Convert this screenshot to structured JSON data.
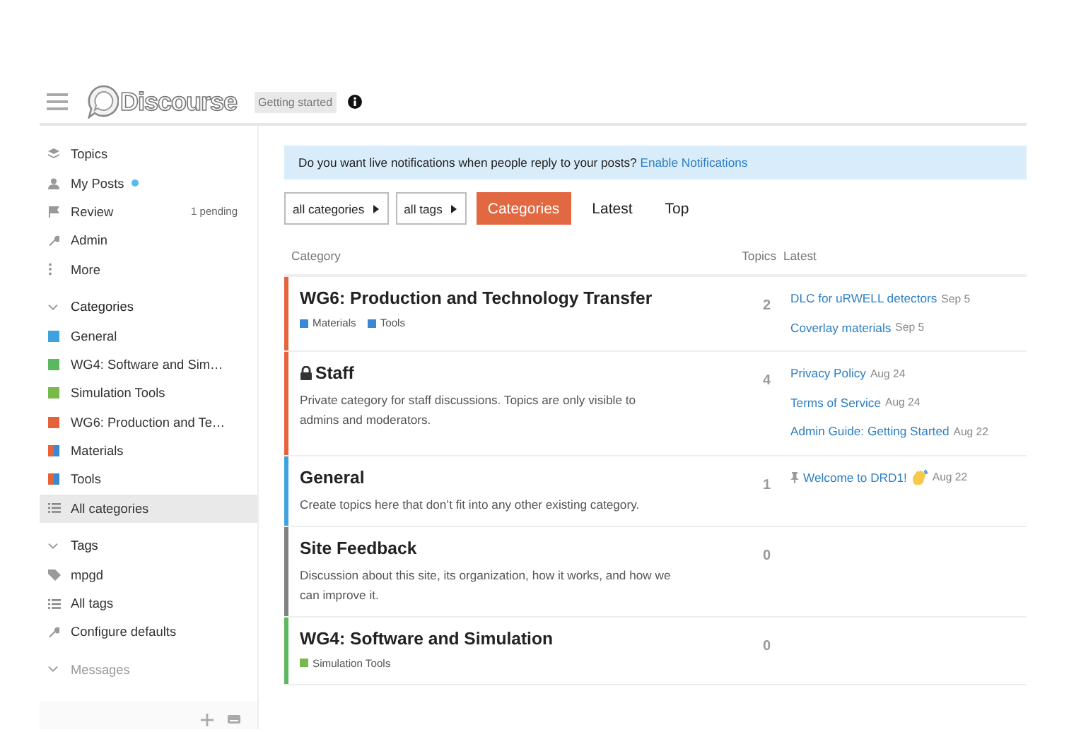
{
  "header": {
    "logo": "Discourse",
    "badge": "Getting started"
  },
  "sidebar": {
    "items": [
      {
        "kind": "topics",
        "label": "Topics"
      },
      {
        "kind": "my-posts",
        "label": "My Posts",
        "unread": true
      },
      {
        "kind": "review",
        "label": "Review",
        "count": "1 pending"
      },
      {
        "kind": "admin",
        "label": "Admin"
      },
      {
        "kind": "more",
        "label": "More"
      }
    ],
    "sections": [
      {
        "title": "Categories",
        "expanded": true,
        "items": [
          {
            "kind": "category",
            "label": "General",
            "color": "#3ea1e0",
            "selected": false
          },
          {
            "kind": "category",
            "label": "WG4: Software and Sim…",
            "color": "#5cb85c",
            "selected": false
          },
          {
            "kind": "category",
            "label": "Simulation Tools",
            "color": "#78b94a",
            "selected": false
          },
          {
            "kind": "category",
            "label": "WG6: Production and Te…",
            "color": "#e5623a",
            "selected": false
          },
          {
            "kind": "subcategory",
            "label": "Materials",
            "color": "#3c86d6",
            "parent": {
              "color": "#e5623a"
            },
            "selected": false
          },
          {
            "kind": "subcategory",
            "label": "Tools",
            "color": "#3c86d6",
            "parent": {
              "color": "#e5623a"
            },
            "selected": false
          },
          {
            "kind": "all",
            "label": "All categories",
            "selected": true
          }
        ]
      },
      {
        "title": "Tags",
        "expanded": true,
        "items": [
          {
            "kind": "tag",
            "label": "mpgd",
            "selected": false
          },
          {
            "kind": "all",
            "label": "All tags",
            "selected": false
          },
          {
            "kind": "configure",
            "label": "Configure defaults",
            "selected": false
          }
        ]
      },
      {
        "title": "Messages",
        "expanded": true,
        "dimmed": true
      }
    ]
  },
  "banner": {
    "text": "Do you want live notifications when people reply to your posts?",
    "link": "Enable Notifications"
  },
  "filters": [
    "all categories",
    "all tags"
  ],
  "tabs": [
    {
      "label": "Categories",
      "selected": true
    },
    {
      "label": "Latest",
      "selected": false
    },
    {
      "label": "Top",
      "selected": false
    }
  ],
  "table": {
    "columns": [
      "Category",
      "Topics",
      "Latest"
    ],
    "rows": [
      {
        "name": "WG6: Production and Technology Transfer",
        "color": "#e5623a",
        "subcategories": [
          {
            "name": "Materials",
            "color": "#3c86d6"
          },
          {
            "name": "Tools",
            "color": "#3c86d6"
          }
        ],
        "topics": "2",
        "latest": [
          {
            "title": "DLC for uRWELL detectors",
            "date": "Sep 5"
          },
          {
            "title": "Coverlay materials",
            "date": "Sep 5"
          }
        ]
      },
      {
        "name": "Staff",
        "locked": true,
        "color": "#e5623a",
        "description": "Private category for staff discussions. Topics are only visible to admins and moderators.",
        "topics": "4",
        "latest": [
          {
            "title": "Privacy Policy",
            "date": "Aug 24"
          },
          {
            "title": "Terms of Service",
            "date": "Aug 24"
          },
          {
            "title": "Admin Guide: Getting Started",
            "date": "Aug 22"
          }
        ]
      },
      {
        "name": "General",
        "color": "#3ea1e0",
        "description": "Create topics here that don’t fit into any other existing category.",
        "topics": "1",
        "latest": [
          {
            "title": "Welcome to DRD1!",
            "date": "Aug 22",
            "pinned": true,
            "emoji": true
          }
        ]
      },
      {
        "name": "Site Feedback",
        "color": "#808281",
        "description": "Discussion about this site, its organization, how it works, and how we can improve it.",
        "topics": "0"
      },
      {
        "name": "WG4: Software and Simulation",
        "color": "#5cb85c",
        "subcategories": [
          {
            "name": "Simulation Tools",
            "color": "#78b94a"
          }
        ],
        "topics": "0"
      }
    ]
  }
}
